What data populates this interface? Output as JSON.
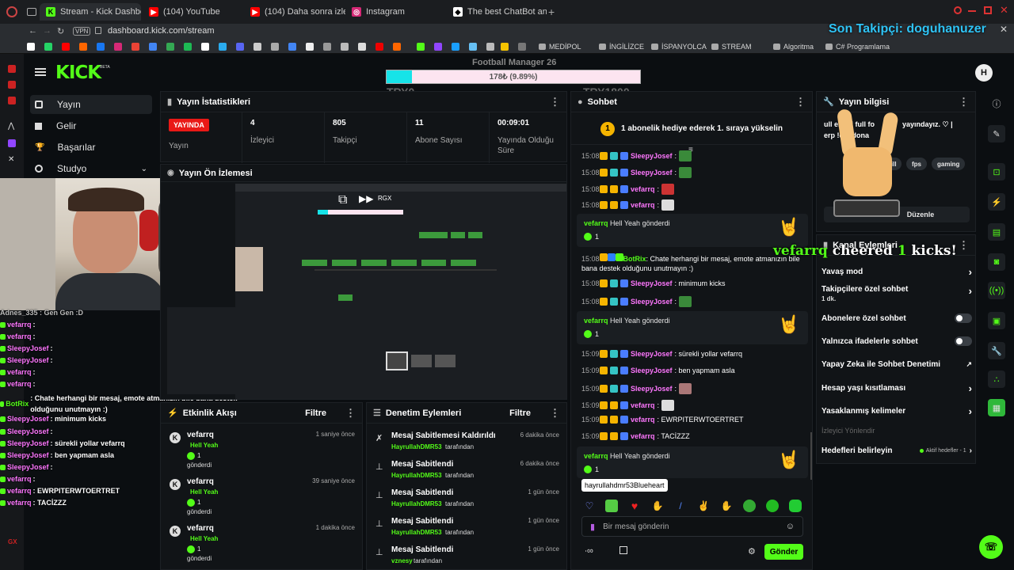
{
  "browser": {
    "tabs": [
      "Stream - Kick Dashboard",
      "(104) YouTube",
      "(104) Daha sonra izle - Yo",
      "Instagram",
      "The best ChatBot and Wi"
    ],
    "vpn": "VPN",
    "url": "dashboard.kick.com/stream",
    "bookmarks": [
      "MEDİPOL",
      "İNGİLİZCE",
      "İSPANYOLCA",
      "STREAM",
      "Algoritma",
      "C# Programlama"
    ]
  },
  "overlay": {
    "last_follower": "Son Takipçi: doguhanuzer",
    "goal_title": "Football Manager 26",
    "goal_progress_text": "178₺ (9.89%)",
    "goal_progress": 9.89,
    "goal_left": "TRY0",
    "goal_right": "TRY1800",
    "cheer_user": "vefarrq",
    "cheer_text": "cheered",
    "cheer_amount": "1",
    "cheer_unit": "kicks!",
    "chat": [
      {
        "user": "Adnes_335 : Gen Gen :D",
        "color": "#bbbbbb",
        "msg": ""
      },
      {
        "user": "vefarrq",
        "color": "#ff77ff",
        "msg": ":"
      },
      {
        "user": "vefarrq",
        "color": "#ff77ff",
        "msg": ":"
      },
      {
        "user": "SleepyJosef",
        "color": "#ff77ff",
        "msg": ":"
      },
      {
        "user": "SleepyJosef",
        "color": "#ff77ff",
        "msg": ":"
      },
      {
        "user": "vefarrq",
        "color": "#ff77ff",
        "msg": ":"
      },
      {
        "user": "vefarrq",
        "color": "#ff77ff",
        "msg": ":"
      },
      {
        "user": "BotRix",
        "color": "#53fc18",
        "msg": ": Chate herhangi bir mesaj, emote atmanızın bile bana destek olduğunu unutmayın :)"
      },
      {
        "user": "SleepyJosef",
        "color": "#ff77ff",
        "msg": ": minimum kicks"
      },
      {
        "user": "SleepyJosef",
        "color": "#ff77ff",
        "msg": ":"
      },
      {
        "user": "SleepyJosef",
        "color": "#ff77ff",
        "msg": ": sürekli yollar vefarrq"
      },
      {
        "user": "SleepyJosef",
        "color": "#ff77ff",
        "msg": ": ben yapmam asla"
      },
      {
        "user": "SleepyJosef",
        "color": "#ff77ff",
        "msg": ":"
      },
      {
        "user": "vefarrq",
        "color": "#ff77ff",
        "msg": ":"
      },
      {
        "user": "vefarrq",
        "color": "#ff77ff",
        "msg": ": EWRPITERWTOERTRET"
      },
      {
        "user": "vefarrq",
        "color": "#ff77ff",
        "msg": ": TACİZZZ"
      }
    ]
  },
  "sidebar": {
    "items": [
      {
        "label": "Yayın",
        "icon": "broadcast-icon"
      },
      {
        "label": "Gelir",
        "icon": "money-icon"
      },
      {
        "label": "Başarılar",
        "icon": "trophy-icon"
      },
      {
        "label": "Studyo",
        "icon": "studio-icon"
      }
    ]
  },
  "stats": {
    "title": "Yayın İstatistikleri",
    "live_badge": "YAYINDA",
    "items": [
      {
        "value": "YAYINDA",
        "label": "Yayın"
      },
      {
        "value": "4",
        "label": "İzleyici"
      },
      {
        "value": "805",
        "label": "Takipçi"
      },
      {
        "value": "11",
        "label": "Abone Sayısı"
      },
      {
        "value": "00:09:01",
        "label": "Yayında Olduğu Süre"
      }
    ]
  },
  "preview": {
    "title": "Yayın Ön İzlemesi",
    "mini_button": "RGX"
  },
  "events": {
    "title": "Etkinlik Akışı",
    "filter": "Filtre",
    "items": [
      {
        "user": "vefarrq",
        "emote": "Hell Yeah",
        "count": "1",
        "sent": "gönderdi",
        "time": "1 saniye önce"
      },
      {
        "user": "vefarrq",
        "emote": "Hell Yeah",
        "count": "1",
        "sent": "gönderdi",
        "time": "39 saniye önce"
      },
      {
        "user": "vefarrq",
        "emote": "Hell Yeah",
        "count": "1",
        "sent": "gönderdi",
        "time": "1 dakika önce"
      }
    ]
  },
  "mod": {
    "title": "Denetim Eylemleri",
    "filter": "Filtre",
    "items": [
      {
        "action": "Mesaj Sabitlemesi Kaldırıldı",
        "by": "HayrullahDMR53",
        "suffix": "tarafından",
        "time": "6 dakika önce"
      },
      {
        "action": "Mesaj Sabitlendi",
        "by": "HayrullahDMR53",
        "suffix": "tarafından",
        "time": "6 dakika önce"
      },
      {
        "action": "Mesaj Sabitlendi",
        "by": "HayrullahDMR53",
        "suffix": "tarafından",
        "time": "1 gün önce"
      },
      {
        "action": "Mesaj Sabitlendi",
        "by": "HayrullahDMR53",
        "suffix": "tarafından",
        "time": "1 gün önce"
      },
      {
        "action": "Mesaj Sabitlendi",
        "by": "vznesy",
        "suffix": "tarafından",
        "time": "1 gün önce"
      }
    ]
  },
  "chat": {
    "title": "Sohbet",
    "gift_rank": "1",
    "gift_text": "1 abonelik hediye ederek 1. sıraya yükselin",
    "lines": [
      {
        "time": "15:08",
        "user": "SleepyJosef",
        "msg": ":",
        "color": "#ff77ff"
      },
      {
        "time": "15:08",
        "user": "SleepyJosef",
        "msg": ":",
        "color": "#ff77ff"
      },
      {
        "time": "15:08",
        "user": "vefarrq",
        "msg": ":",
        "color": "#ff77ff"
      },
      {
        "time": "15:08",
        "user": "vefarrq",
        "msg": ":",
        "color": "#ff77ff"
      },
      {
        "time": "15:08",
        "user": "BotRix",
        "msg": ": Chate herhangi bir mesaj, emote atmanızın bile bana destek olduğunu unutmayın :)",
        "color": "#53fc18"
      },
      {
        "time": "15:08",
        "user": "SleepyJosef",
        "msg": ": minimum kicks",
        "color": "#ff77ff"
      },
      {
        "time": "15:08",
        "user": "SleepyJosef",
        "msg": ":",
        "color": "#ff77ff"
      },
      {
        "time": "15:09",
        "user": "SleepyJosef",
        "msg": ": sürekli yollar vefarrq",
        "color": "#ff77ff"
      },
      {
        "time": "15:09",
        "user": "SleepyJosef",
        "msg": ": ben yapmam asla",
        "color": "#ff77ff"
      },
      {
        "time": "15:09",
        "user": "SleepyJosef",
        "msg": ":",
        "color": "#ff77ff"
      },
      {
        "time": "15:09",
        "user": "vefarrq",
        "msg": ":",
        "color": "#ff77ff"
      },
      {
        "time": "15:09",
        "user": "vefarrq",
        "msg": ": EWRPITERWTOERTRET",
        "color": "#ff77ff"
      },
      {
        "time": "15:09",
        "user": "vefarrq",
        "msg": ": TACİZZZ",
        "color": "#ff77ff"
      }
    ],
    "gifts": [
      {
        "user": "vefarrq",
        "text": "Hell Yeah gönderdi",
        "count": "1"
      },
      {
        "user": "vefarrq",
        "text": "Hell Yeah gönderdi",
        "count": "1"
      },
      {
        "user": "vefarrq",
        "text": "Hell Yeah gönderdi",
        "count": "1"
      }
    ],
    "tooltip": "hayrullahdmr53Blueheart",
    "input_placeholder": "Bir mesaj gönderin",
    "send": "Gönder"
  },
  "info": {
    "title": "Yayın bilgisi",
    "desc_a": "ull enerji full fo",
    "desc_b": "yayındayız. ♡ |",
    "desc_c": "erp !dc !dona",
    "tags": [
      "hill",
      "fps",
      "gaming"
    ],
    "edit": "Düzenle"
  },
  "channel": {
    "title": "Kanal Eylemleri",
    "items": [
      {
        "label": "Yavaş mod",
        "sub": "",
        "ctl": "arrow"
      },
      {
        "label": "Takipçilere özel sohbet",
        "sub": "1 dk.",
        "ctl": "arrow"
      },
      {
        "label": "Abonelere özel sohbet",
        "sub": "",
        "ctl": "toggle"
      },
      {
        "label": "Yalnızca ifadelerle sohbet",
        "sub": "",
        "ctl": "toggle"
      },
      {
        "label": "Yapay Zeka ile Sohbet Denetimi",
        "sub": "",
        "ctl": "ext"
      },
      {
        "label": "Hesap yaşı kısıtlaması",
        "sub": "",
        "ctl": "arrow"
      },
      {
        "label": "Yasaklanmış kelimeler",
        "sub": "",
        "ctl": "arrow"
      }
    ],
    "section": "İzleyici Yönlendir",
    "goals_label": "Hedefleri belirleyin",
    "goals_status": "Aktif hedefler - 1"
  },
  "colors": {
    "accent": "#53fc18",
    "bg": "#0b0e11",
    "panel": "#111417",
    "live": "#e91916"
  }
}
